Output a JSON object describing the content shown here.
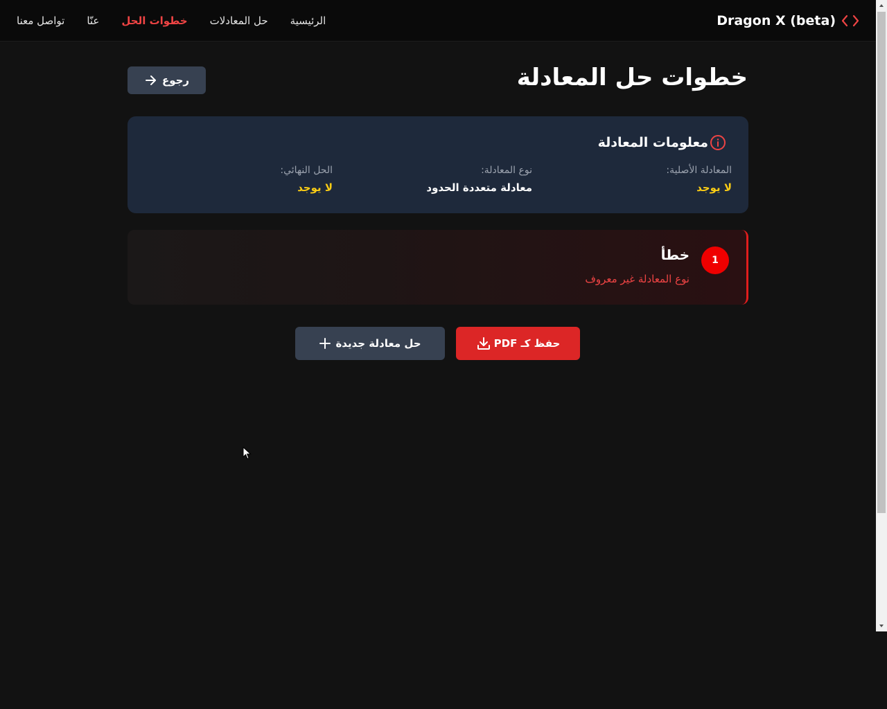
{
  "nav": {
    "brand": "Dragon X (beta)",
    "links": [
      {
        "label": "الرئيسية"
      },
      {
        "label": "حل المعادلات"
      },
      {
        "label": "خطوات الحل",
        "active": true
      },
      {
        "label": "عنّا"
      },
      {
        "label": "تواصل معنا"
      }
    ]
  },
  "header": {
    "title": "خطوات حل المعادلة",
    "back_label": "رجوع"
  },
  "info": {
    "title": "معلومات المعادلة",
    "original_label": "المعادلة الأصلية:",
    "original_value": "لا يوجد",
    "type_label": "نوع المعادلة:",
    "type_value": "معادلة متعددة الحدود",
    "final_label": "الحل النهائي:",
    "final_value": "لا يوجد"
  },
  "steps": [
    {
      "number": "1",
      "title": "خطأ",
      "description": "نوع المعادلة غير معروف"
    }
  ],
  "actions": {
    "save_pdf_label": "حفظ كـ PDF",
    "new_equation_label": "حل معادلة جديدة"
  },
  "colors": {
    "accent": "#ef4444",
    "highlight": "#facc15",
    "card": "#1e293b",
    "button_secondary": "#374151",
    "button_primary": "#dc2626"
  }
}
